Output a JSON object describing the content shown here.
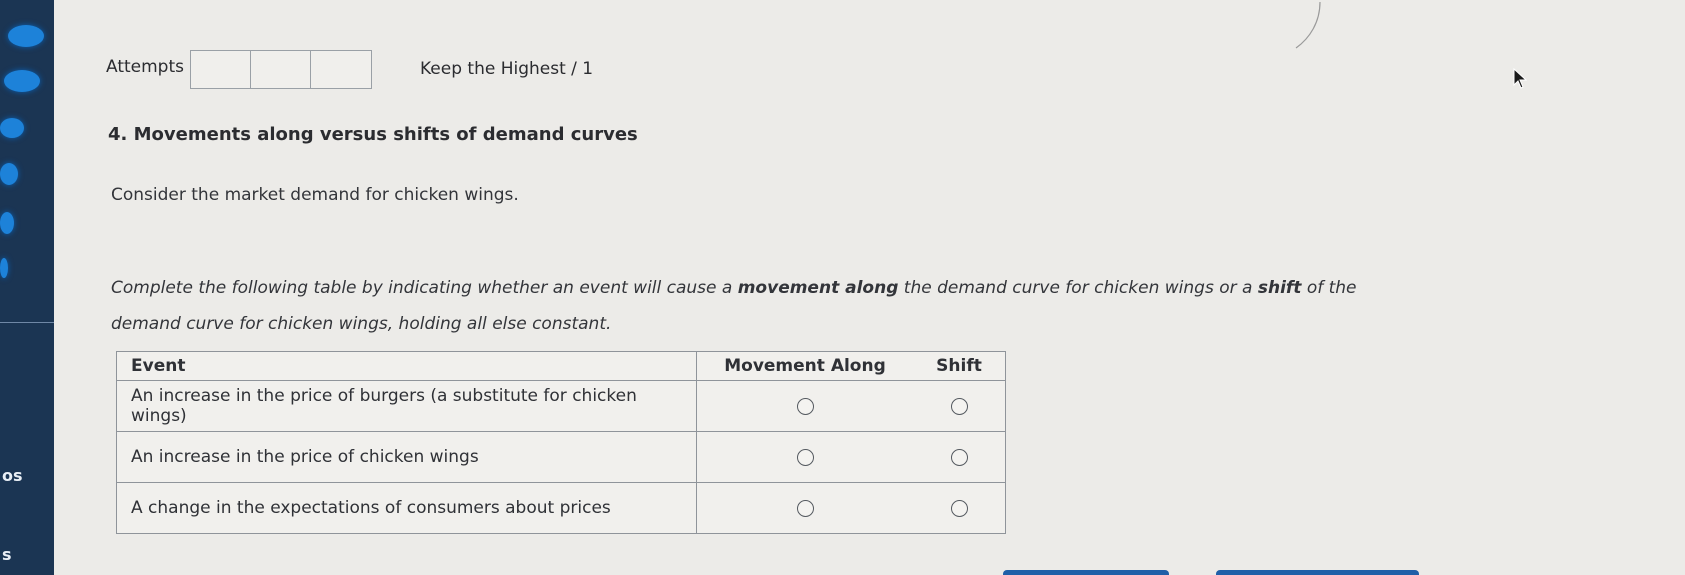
{
  "sidebar": {
    "strip_text_1": "os",
    "strip_text_2": "s"
  },
  "attempts": {
    "label": "Attempts",
    "box_count": 3,
    "keep_label": "Keep the Highest / 1"
  },
  "question": {
    "title": "4. Movements along versus shifts of demand curves",
    "intro": "Consider the market demand for chicken wings.",
    "instruction_parts": {
      "p1": "Complete the following table by indicating whether an event will cause a ",
      "b1": "movement along",
      "p2": " the demand curve for chicken wings or a ",
      "b2": "shift",
      "p3": " of the demand curve for chicken wings, holding all else constant."
    }
  },
  "table": {
    "headers": {
      "event": "Event",
      "movement": "Movement Along",
      "shift": "Shift"
    },
    "rows": [
      {
        "event": "An increase in the price of burgers (a substitute for chicken wings)"
      },
      {
        "event": "An increase in the price of chicken wings"
      },
      {
        "event": "A change in the expectations of consumers about prices"
      }
    ]
  }
}
